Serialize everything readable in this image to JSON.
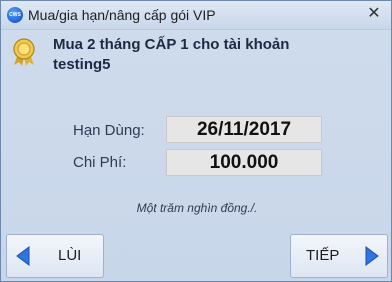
{
  "window": {
    "title": "Mua/gia hạn/nâng cấp gói VIP"
  },
  "header": {
    "line1": "Mua 2 tháng CẤP 1 cho tài khoản",
    "line2": "testing5"
  },
  "details": {
    "expiry_label": "Hạn Dùng:",
    "expiry_value": "26/11/2017",
    "cost_label": "Chi Phí:",
    "cost_value": "100.000",
    "cost_in_words": "Một trăm nghìn đồng./."
  },
  "buttons": {
    "back_label": "LÙI",
    "next_label": "TIẾP"
  },
  "icons": {
    "app": "app-logo-icon",
    "close": "close-icon",
    "award": "award-ribbon-icon",
    "back": "triangle-left-icon",
    "next": "triangle-right-icon"
  },
  "colors": {
    "accent": "#1f5fd6",
    "window_bg": "#cbd9ec",
    "value_bg": "#e6e6e6"
  }
}
